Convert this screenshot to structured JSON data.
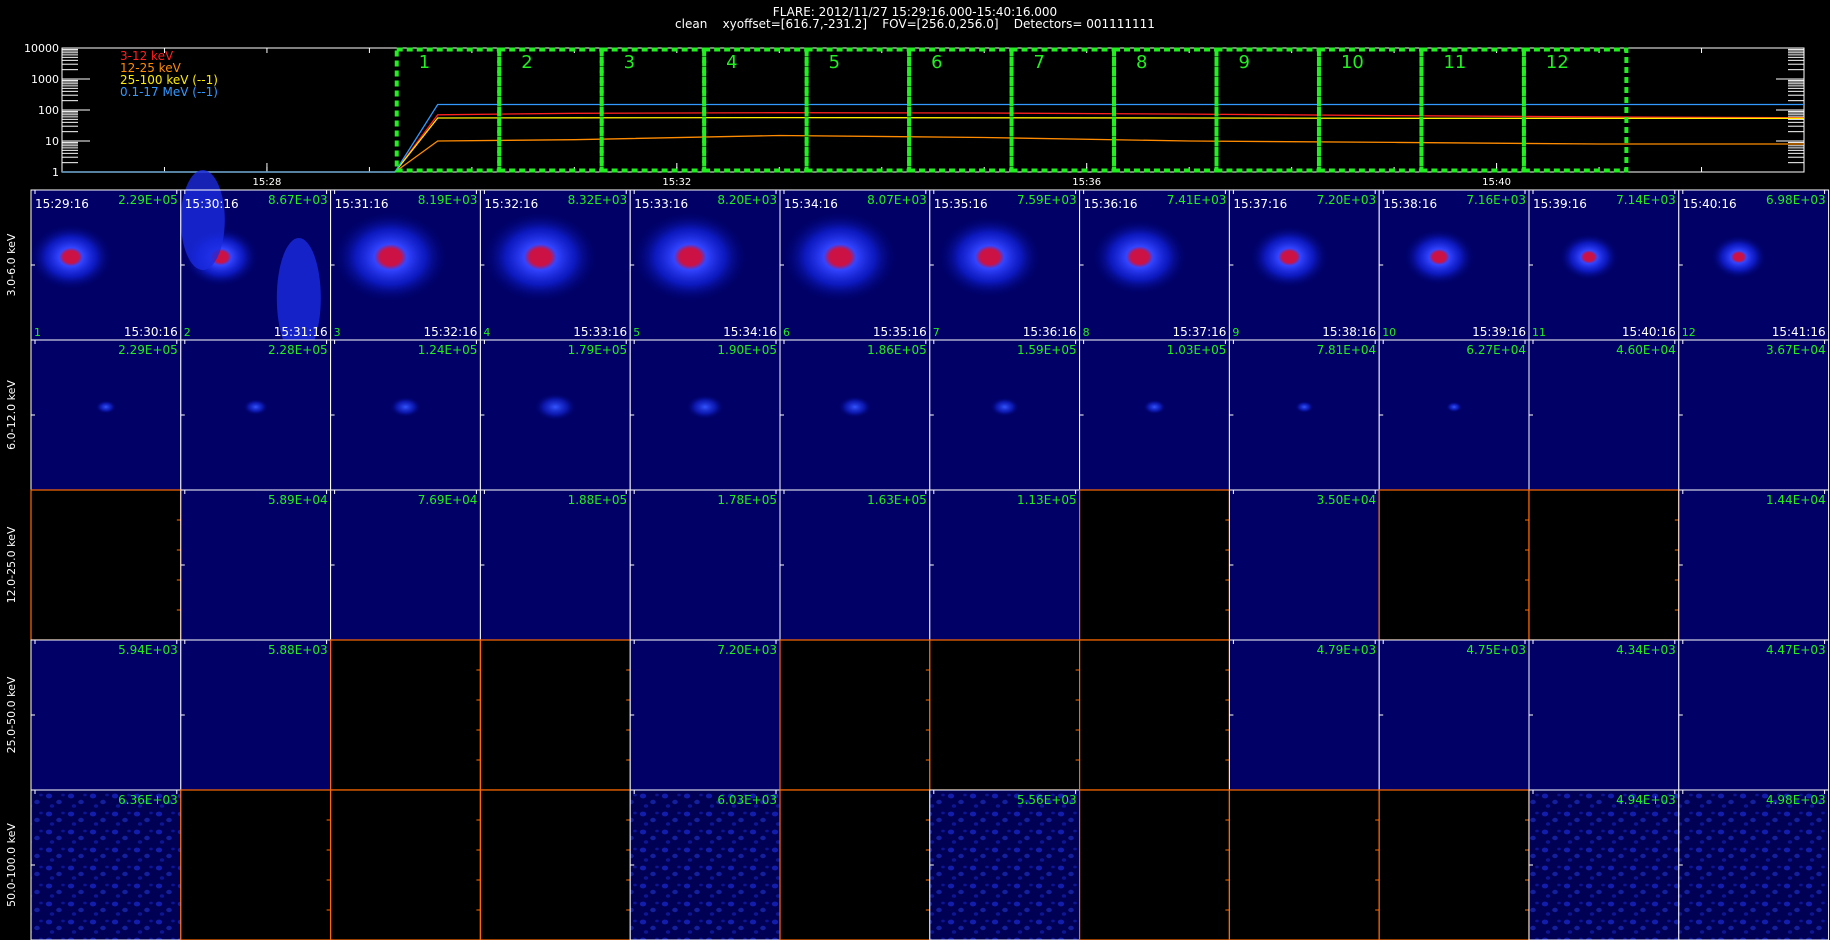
{
  "header": {
    "line1": "FLARE: 2012/11/27 15:29:16.000-15:40:16.000",
    "line2": "clean    xyoffset=[616.7,-231.2]    FOV=[256.0,256.0]    Detectors= 001111111"
  },
  "colors": {
    "background": "#000000",
    "frame": "#ffffff",
    "interval_box": "#22ee22",
    "value_label": "#22ee22",
    "empty_panel_axis": "#ff6a00",
    "flare_core": "#cc1144",
    "flare_glow": "#1133ff",
    "panel_fill": "#000066"
  },
  "chart_data": [
    {
      "type": "line",
      "title": "",
      "xlabel": "",
      "ylabel": "",
      "yscale": "log",
      "ylim": [
        1,
        10000
      ],
      "ytick_labels": [
        "1",
        "10",
        "100",
        "1000",
        "10000"
      ],
      "xlim": [
        "15:26:00",
        "15:43:00"
      ],
      "xtick_labels": [
        "15:28",
        "15:32",
        "15:36",
        "15:40"
      ],
      "legend_position": "top-left",
      "series": [
        {
          "name": "3-12 keV",
          "color": "#ff2020",
          "x": [
            "15:26:00",
            "15:28:00",
            "15:29:15",
            "15:29:40",
            "15:31:00",
            "15:33:00",
            "15:35:00",
            "15:37:00",
            "15:39:00",
            "15:41:00",
            "15:43:00"
          ],
          "values": [
            1,
            1,
            1,
            70,
            78,
            82,
            80,
            74,
            66,
            60,
            56
          ]
        },
        {
          "name": "12-25 keV",
          "color": "#ff8c00",
          "x": [
            "15:26:00",
            "15:28:00",
            "15:29:15",
            "15:29:40",
            "15:31:00",
            "15:33:00",
            "15:35:00",
            "15:37:00",
            "15:39:00",
            "15:41:00",
            "15:43:00"
          ],
          "values": [
            1,
            1,
            1,
            10,
            11,
            15,
            13,
            10,
            9,
            8,
            8
          ]
        },
        {
          "name": "25-100 keV (--1)",
          "color": "#ffee00",
          "x": [
            "15:26:00",
            "15:28:00",
            "15:29:15",
            "15:29:40",
            "15:31:00",
            "15:33:00",
            "15:35:00",
            "15:37:00",
            "15:39:00",
            "15:41:00",
            "15:43:00"
          ],
          "values": [
            1,
            1,
            1,
            55,
            56,
            57,
            56,
            55,
            54,
            54,
            54
          ]
        },
        {
          "name": "0.1-17 MeV (--1)",
          "color": "#3399ff",
          "x": [
            "15:26:00",
            "15:28:00",
            "15:29:15",
            "15:29:40",
            "15:31:00",
            "15:33:00",
            "15:35:00",
            "15:37:00",
            "15:39:00",
            "15:41:00",
            "15:43:00"
          ],
          "values": [
            1,
            1,
            1,
            150,
            150,
            150,
            150,
            150,
            150,
            150,
            150
          ]
        }
      ],
      "interval_boxes": [
        {
          "label": "1",
          "start": "15:29:16",
          "end": "15:30:16"
        },
        {
          "label": "2",
          "start": "15:30:16",
          "end": "15:31:16"
        },
        {
          "label": "3",
          "start": "15:31:16",
          "end": "15:32:16"
        },
        {
          "label": "4",
          "start": "15:32:16",
          "end": "15:33:16"
        },
        {
          "label": "5",
          "start": "15:33:16",
          "end": "15:34:16"
        },
        {
          "label": "6",
          "start": "15:34:16",
          "end": "15:35:16"
        },
        {
          "label": "7",
          "start": "15:35:16",
          "end": "15:36:16"
        },
        {
          "label": "8",
          "start": "15:36:16",
          "end": "15:37:16"
        },
        {
          "label": "9",
          "start": "15:37:16",
          "end": "15:38:16"
        },
        {
          "label": "10",
          "start": "15:38:16",
          "end": "15:39:16"
        },
        {
          "label": "11",
          "start": "15:39:16",
          "end": "15:40:16"
        },
        {
          "label": "12",
          "start": "15:40:16",
          "end": "15:41:16"
        }
      ]
    },
    {
      "type": "heatmap",
      "title": "",
      "columns": [
        {
          "index": "1",
          "start": "15:29:16",
          "end": "15:30:16"
        },
        {
          "index": "2",
          "start": "15:30:16",
          "end": "15:31:16"
        },
        {
          "index": "3",
          "start": "15:31:16",
          "end": "15:32:16"
        },
        {
          "index": "4",
          "start": "15:32:16",
          "end": "15:33:16"
        },
        {
          "index": "5",
          "start": "15:33:16",
          "end": "15:34:16"
        },
        {
          "index": "6",
          "start": "15:34:16",
          "end": "15:35:16"
        },
        {
          "index": "7",
          "start": "15:35:16",
          "end": "15:36:16"
        },
        {
          "index": "8",
          "start": "15:36:16",
          "end": "15:37:16"
        },
        {
          "index": "9",
          "start": "15:37:16",
          "end": "15:38:16"
        },
        {
          "index": "10",
          "start": "15:38:16",
          "end": "15:39:16"
        },
        {
          "index": "11",
          "start": "15:39:16",
          "end": "15:40:16"
        },
        {
          "index": "12",
          "start": "15:40:16",
          "end": "15:41:16"
        }
      ],
      "rows": [
        {
          "band": "3.0-6.0 keV",
          "max_values": [
            "2.29E+05",
            "8.67E+03",
            "8.19E+03",
            "8.32E+03",
            "8.20E+03",
            "8.07E+03",
            "7.59E+03",
            "7.41E+03",
            "7.20E+03",
            "7.16E+03",
            "7.14E+03",
            "6.98E+03"
          ],
          "source_strength": [
            0.6,
            0.5,
            1,
            1,
            1,
            1,
            0.85,
            0.75,
            0.55,
            0.45,
            0.3,
            0.25
          ],
          "has_image": [
            true,
            true,
            true,
            true,
            true,
            true,
            true,
            true,
            true,
            true,
            true,
            true
          ]
        },
        {
          "band": "6.0-12.0 keV",
          "max_values": [
            "2.29E+05",
            "2.28E+05",
            "1.24E+05",
            "1.79E+05",
            "1.90E+05",
            "1.86E+05",
            "1.59E+05",
            "1.03E+05",
            "7.81E+04",
            "6.27E+04",
            "4.60E+04",
            "3.67E+04"
          ],
          "source_strength": [
            0.2,
            0.3,
            0.45,
            0.7,
            0.6,
            0.5,
            0.4,
            0.25,
            0.15,
            0.1,
            0.0,
            0.0
          ],
          "has_image": [
            true,
            true,
            true,
            true,
            true,
            true,
            true,
            true,
            true,
            true,
            true,
            true
          ]
        },
        {
          "band": "12.0-25.0 keV",
          "max_values": [
            "",
            "5.89E+04",
            "7.69E+04",
            "1.88E+05",
            "1.78E+05",
            "1.63E+05",
            "1.13E+05",
            "",
            "3.50E+04",
            "",
            "",
            "1.44E+04"
          ],
          "source_strength": [
            0,
            0,
            0,
            0,
            0,
            0,
            0,
            0,
            0,
            0,
            0,
            0
          ],
          "has_image": [
            false,
            true,
            true,
            true,
            true,
            true,
            true,
            false,
            true,
            false,
            false,
            true
          ]
        },
        {
          "band": "25.0-50.0 keV",
          "max_values": [
            "5.94E+03",
            "5.88E+03",
            "",
            "",
            "7.20E+03",
            "",
            "",
            "",
            "4.79E+03",
            "4.75E+03",
            "4.34E+03",
            "4.47E+03"
          ],
          "source_strength": [
            0,
            0,
            0,
            0,
            0,
            0,
            0,
            0,
            0,
            0,
            0,
            0
          ],
          "has_image": [
            true,
            true,
            false,
            false,
            true,
            false,
            false,
            false,
            true,
            true,
            true,
            true
          ]
        },
        {
          "band": "50.0-100.0 keV",
          "max_values": [
            "6.36E+03",
            "",
            "",
            "",
            "6.03E+03",
            "",
            "5.56E+03",
            "",
            "",
            "",
            "4.94E+03",
            "4.98E+03"
          ],
          "source_strength": [
            0,
            0,
            0,
            0,
            0,
            0,
            0,
            0,
            0,
            0,
            0,
            0
          ],
          "has_image": [
            true,
            false,
            false,
            false,
            true,
            false,
            true,
            false,
            false,
            false,
            true,
            true
          ]
        }
      ]
    }
  ]
}
